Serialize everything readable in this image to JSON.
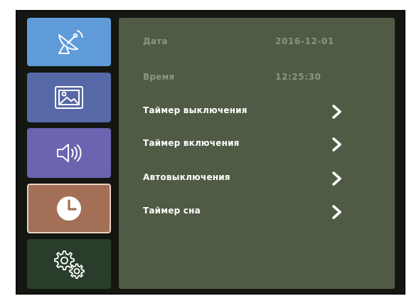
{
  "sidebar": {
    "tabs": [
      {
        "name": "satellite-tab",
        "icon": "satellite-dish-icon",
        "selected": false
      },
      {
        "name": "gallery-tab",
        "icon": "picture-icon",
        "selected": false
      },
      {
        "name": "sound-tab",
        "icon": "speaker-icon",
        "selected": false
      },
      {
        "name": "clock-tab",
        "icon": "clock-icon",
        "selected": true
      },
      {
        "name": "settings-tab",
        "icon": "gears-icon",
        "selected": false
      }
    ]
  },
  "panel": {
    "date": {
      "label": "Дата",
      "value": "2016-12-01"
    },
    "time": {
      "label": "Время",
      "value": "12:25:30"
    },
    "items": [
      {
        "label": "Таймер выключения"
      },
      {
        "label": "Таймер включения"
      },
      {
        "label": "Автовыключения"
      },
      {
        "label": "Таймер сна"
      }
    ]
  },
  "colors": {
    "screen_bg": "#141612",
    "panel_bg": "#4f5b45",
    "dim_text": "#8c9582",
    "item_text": "#ffffff",
    "selected_tab": "#a36f57"
  }
}
